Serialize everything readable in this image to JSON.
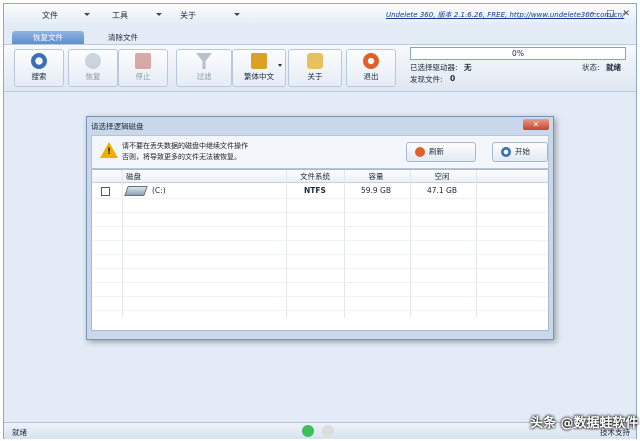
{
  "menubar": {
    "items": [
      "文件",
      "工具",
      "关于"
    ],
    "title": "Undelete 360, 版本 2.1.6.26, FREE, http://www.undelete360.com/cn/",
    "window_buttons": [
      "—",
      "□",
      "✕"
    ]
  },
  "tabs": {
    "recover": "恢复文件",
    "wipe": "清除文件"
  },
  "toolbar": {
    "search": "搜索",
    "recover": "恢复",
    "stop": "停止",
    "filter": "过滤",
    "language": "繁体中文",
    "about": "关于",
    "exit": "退出"
  },
  "progress": {
    "text": "0%",
    "value": 0
  },
  "info": {
    "selected_drive_label": "已选择驱动器:",
    "selected_drive_value": "无",
    "found_files_label": "发现文件:",
    "found_files_value": "0",
    "status_label": "状态:",
    "status_value": "就绪"
  },
  "dialog": {
    "title": "请选择逻辑磁盘",
    "close": "✕",
    "warning_line1": "请不要在丢失数据的磁盘中继续文件操作",
    "warning_line2": "否则，将导致更多的文件无法被恢复。",
    "refresh": "刷新",
    "start": "开始",
    "columns": [
      "磁盘",
      "文件系统",
      "容量",
      "空闲"
    ],
    "rows": [
      {
        "disk": "(C:)",
        "filesystem": "NTFS",
        "capacity": "59.9 GB",
        "free": "47.1 GB"
      }
    ]
  },
  "statusbar": {
    "left": "就绪",
    "right": "技术支持"
  },
  "watermark": "头条 @数据蛙软件",
  "colors": {
    "accent": "#5b8ccc",
    "green_dot": "#3fbf5a"
  }
}
